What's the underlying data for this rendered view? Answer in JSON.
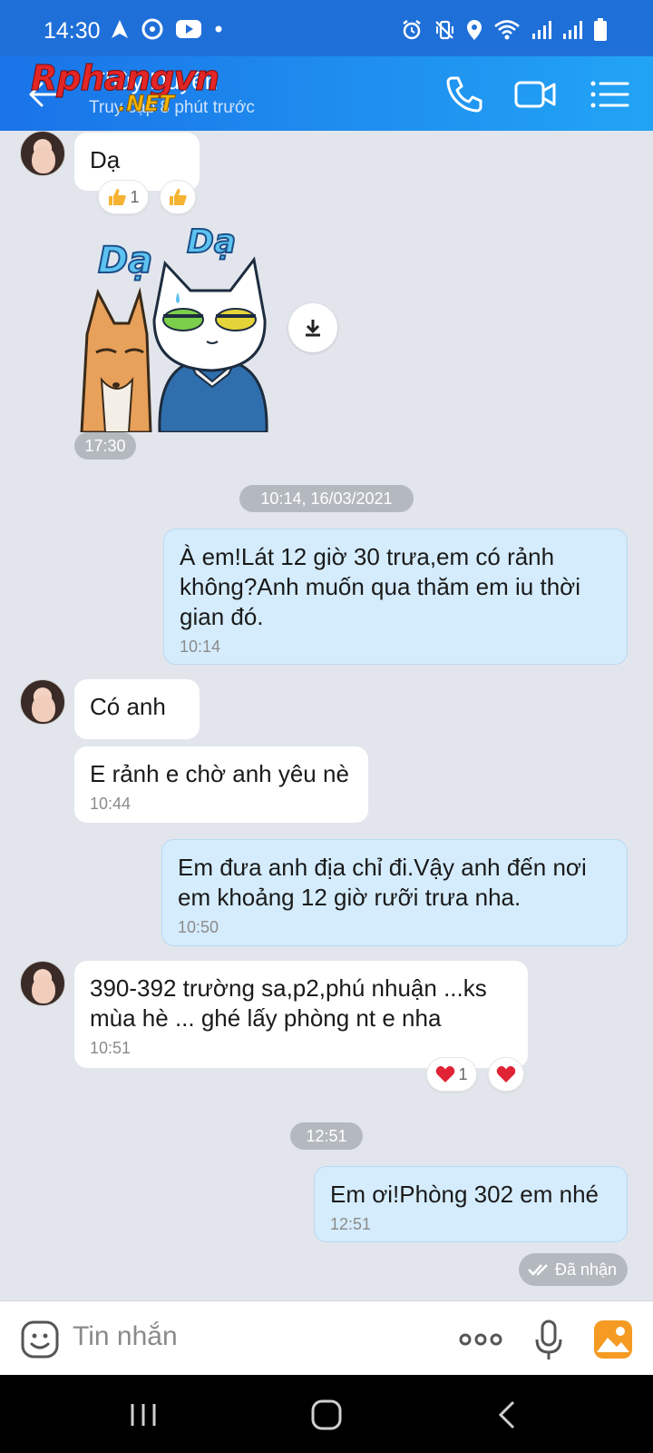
{
  "status_bar": {
    "time": "14:30",
    "left_icons": [
      "navigation-icon",
      "messenger-icon",
      "youtube-icon",
      "dot-icon"
    ],
    "right_icons": [
      "alarm-icon",
      "vibrate-icon",
      "location-icon",
      "wifi-icon",
      "signal-icon",
      "signal-icon",
      "battery-icon"
    ]
  },
  "header": {
    "contact_name": "Thùy Duyên",
    "contact_status": "Truy cập 8 phút trước",
    "watermark": {
      "main": "Rphangvn",
      "sub": ".NET"
    },
    "colors": {
      "start": "#1a73e8",
      "end": "#22a4f5"
    }
  },
  "messages": {
    "m1": {
      "text": "Dạ",
      "reaction_count": "1"
    },
    "sticker": {
      "time": "17:30"
    },
    "date_chip": "10:14, 16/03/2021",
    "m2": {
      "text": "À em!Lát 12 giờ 30 trưa,em có rảnh không?Anh muốn qua thăm em iu thời gian đó.",
      "time": "10:14"
    },
    "m3": {
      "text": "Có anh"
    },
    "m4": {
      "text": "E rảnh e chờ anh yêu nè",
      "time": "10:44"
    },
    "m5": {
      "text": "Em đưa anh địa chỉ đi.Vậy anh đến nơi em khoảng 12 giờ rưỡi trưa nha.",
      "time": "10:50"
    },
    "m6": {
      "text": "390-392 trường sa,p2,phú nhuận ...ks mùa hè ... ghé lấy phòng nt e nha",
      "time": "10:51",
      "reaction_count": "1"
    },
    "time_chip": "12:51",
    "m7": {
      "text": "Em ơi!Phòng 302 em nhé",
      "time": "12:51"
    },
    "seen": "Đã nhận"
  },
  "composer": {
    "placeholder": "Tin nhắn"
  },
  "colors": {
    "chat_bg": "#e2e6ec",
    "outgoing_bubble": "#d5ecfd",
    "incoming_bubble": "#ffffff",
    "accent": "#1a73e8"
  }
}
